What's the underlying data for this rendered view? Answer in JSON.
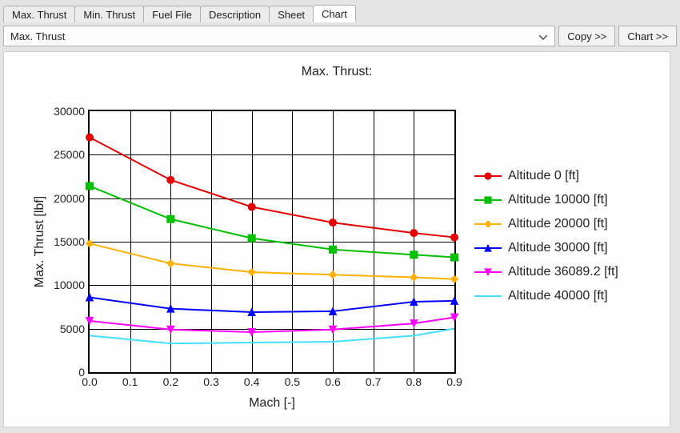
{
  "tabs": {
    "items": [
      "Max. Thrust",
      "Min. Thrust",
      "Fuel File",
      "Description",
      "Sheet",
      "Chart"
    ],
    "active_index": 5
  },
  "toolbar": {
    "dropdown_value": "Max. Thrust",
    "copy_label": "Copy >>",
    "chart_label": "Chart >>"
  },
  "chart_data": {
    "type": "line",
    "title": "Max. Thrust:",
    "xlabel": "Mach [-]",
    "ylabel": "Max. Thrust [lbf]",
    "x": [
      0.0,
      0.2,
      0.4,
      0.6,
      0.8,
      0.9
    ],
    "x_ticks": [
      0.0,
      0.1,
      0.2,
      0.3,
      0.4,
      0.5,
      0.6,
      0.7,
      0.8,
      0.9
    ],
    "y_ticks": [
      0,
      5000,
      10000,
      15000,
      20000,
      25000,
      30000
    ],
    "xlim": [
      0.0,
      0.9
    ],
    "ylim": [
      0,
      30000
    ],
    "grid": true,
    "series": [
      {
        "name": "Altitude 0 [ft]",
        "color": "#e60000",
        "marker": "circle",
        "values": [
          27000,
          22100,
          19000,
          17200,
          16000,
          15500
        ]
      },
      {
        "name": "Altitude 10000 [ft]",
        "color": "#00c000",
        "marker": "square",
        "values": [
          21400,
          17600,
          15400,
          14100,
          13500,
          13200
        ]
      },
      {
        "name": "Altitude 20000 [ft]",
        "color": "#ffb000",
        "marker": "diamond",
        "values": [
          14800,
          12500,
          11500,
          11200,
          10900,
          10700
        ]
      },
      {
        "name": "Altitude 30000 [ft]",
        "color": "#0000ff",
        "marker": "triangle-up",
        "values": [
          8600,
          7300,
          6900,
          7000,
          8100,
          8200
        ]
      },
      {
        "name": "Altitude 36089.2 [ft]",
        "color": "#ff00ff",
        "marker": "triangle-down",
        "values": [
          5900,
          4900,
          4600,
          4900,
          5600,
          6300
        ]
      },
      {
        "name": "Altitude 40000 [ft]",
        "color": "#44e0ff",
        "marker": "none",
        "values": [
          4200,
          3300,
          3400,
          3500,
          4200,
          5000
        ]
      }
    ]
  }
}
